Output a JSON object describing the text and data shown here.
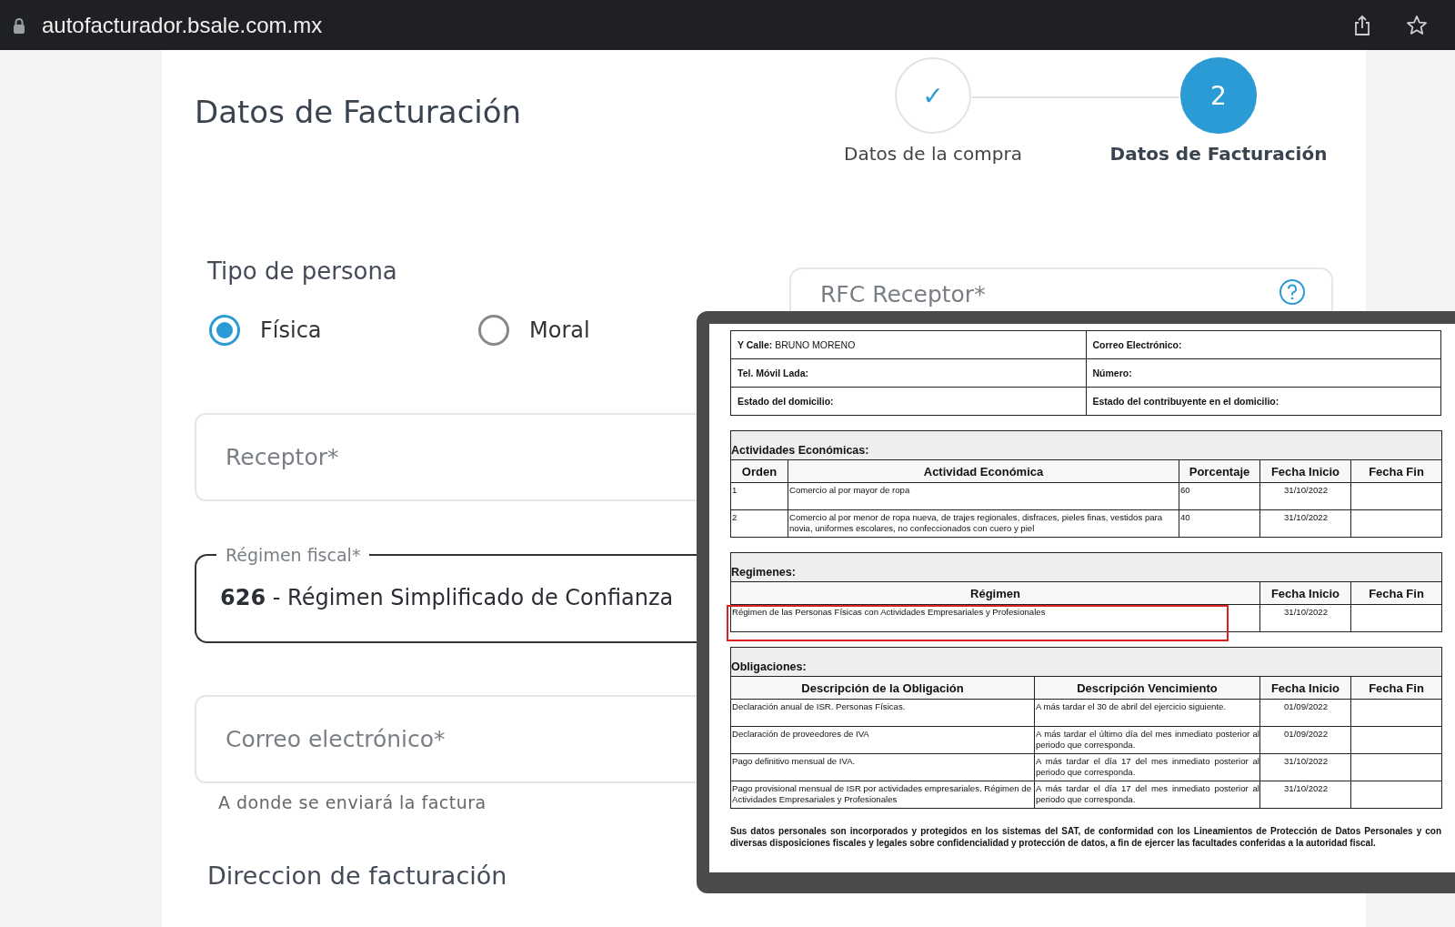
{
  "browser": {
    "url": "autofacturador.bsale.com.mx"
  },
  "page_title": "Datos de Facturación",
  "steps": [
    {
      "mark": "✓",
      "label": "Datos de la compra",
      "selected": false
    },
    {
      "mark": "2",
      "label": "Datos de Facturación",
      "selected": true
    }
  ],
  "tipo_persona": {
    "label": "Tipo de persona",
    "options": [
      {
        "label": "Física",
        "selected": true
      },
      {
        "label": "Moral",
        "selected": false
      }
    ]
  },
  "receptor_field": {
    "placeholder": "Receptor*"
  },
  "rfc_field": {
    "placeholder": "RFC Receptor*"
  },
  "regimen_field": {
    "label": "Régimen fiscal*",
    "value": "**626** - Régimen Simplificado de Confianza"
  },
  "correo_field": {
    "placeholder": "Correo electrónico*",
    "helper": "A donde se enviará la factura"
  },
  "section_heading": "Direccion de facturación",
  "document": {
    "contact_rows": [
      [
        {
          "label": "Y Calle:",
          "value": "BRUNO MORENO"
        },
        {
          "label": "Correo Electrónico:"
        }
      ],
      [
        {
          "label": "Tel. Móvil Lada:"
        },
        {
          "label": "Número:"
        }
      ],
      [
        {
          "label": "Estado del domicilio:"
        },
        {
          "label": "Estado del contribuyente en el domicilio:"
        }
      ]
    ],
    "sections": [
      {
        "kind": "activities",
        "title": "Actividades Económicas:",
        "columns": [
          "Orden",
          "Actividad Económica",
          "Porcentaje",
          "Fecha Inicio",
          "Fecha Fin"
        ],
        "rows": [
          {
            "highlighted": false,
            "cells": [
              "1",
              "Comercio al por mayor de ropa",
              "60",
              "31/10/2022"
            ]
          },
          {
            "highlighted": false,
            "cells": [
              "2",
              "Comercio al por menor de ropa nueva, de trajes regionales, disfraces, pieles finas, vestidos para novia, uniformes escolares, no confeccionados con cuero y piel",
              "40",
              "31/10/2022"
            ]
          }
        ]
      },
      {
        "kind": "regimes",
        "title": "Regimenes:",
        "columns": [
          "Régimen",
          "Fecha Inicio",
          "Fecha Fin"
        ],
        "rows": [
          {
            "highlighted": true,
            "cells": [
              "Régimen de las Personas Físicas con Actividades Empresariales y Profesionales",
              "31/10/2022"
            ]
          }
        ]
      },
      {
        "kind": "obligations",
        "title": "Obligaciones:",
        "columns": [
          "Descripción de la Obligación",
          "Descripción Vencimiento",
          "Fecha Inicio",
          "Fecha Fin"
        ],
        "rows": [
          {
            "highlighted": false,
            "cells": [
              "Declaración anual de ISR. Personas Físicas.",
              "A más tardar el 30 de abril del ejercicio siguiente.",
              "01/09/2022"
            ]
          },
          {
            "highlighted": false,
            "cells": [
              "Declaración de proveedores de IVA",
              "A más tardar el último día del mes inmediato posterior al periodo que corresponda.",
              "01/09/2022"
            ]
          },
          {
            "highlighted": false,
            "cells": [
              "Pago definitivo mensual de IVA.",
              "A más tardar el día 17 del mes inmediato posterior al periodo que corresponda.",
              "31/10/2022"
            ]
          },
          {
            "highlighted": false,
            "cells": [
              "Pago provisional mensual de ISR por actividades empresariales. Régimen de Actividades Empresariales y Profesionales",
              "A más tardar el día 17 del mes inmediato posterior al periodo que corresponda.",
              "31/10/2022"
            ]
          }
        ]
      }
    ],
    "notice": "Sus datos personales son incorporados y protegidos en los sistemas del SAT, de conformidad con los Lineamientos de Protección de Datos Personales y con diversas disposiciones fiscales y legales sobre confidencialidad y protección de datos, a fin de ejercer las facultades conferidas a la autoridad fiscal."
  }
}
